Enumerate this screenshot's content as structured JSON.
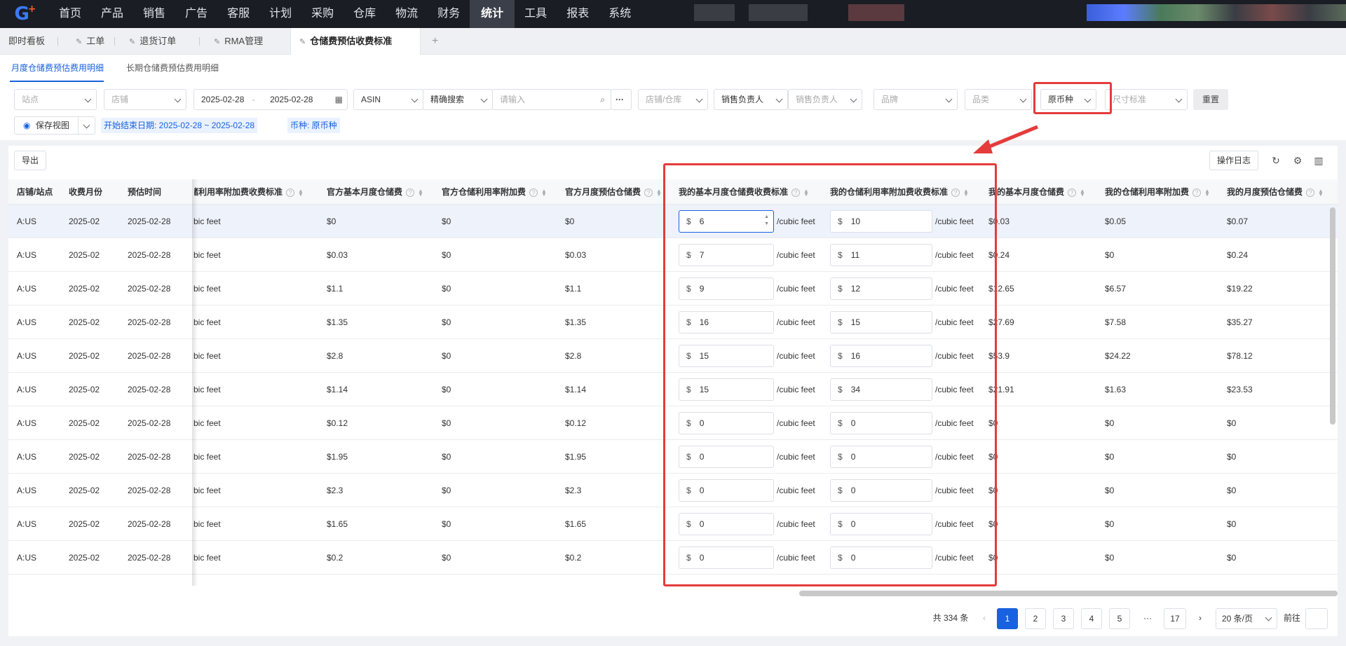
{
  "nav": {
    "items": [
      "首页",
      "产品",
      "销售",
      "广告",
      "客服",
      "计划",
      "采购",
      "仓库",
      "物流",
      "财务",
      "统计",
      "工具",
      "报表",
      "系统"
    ],
    "active_index": 10
  },
  "tabs": {
    "items": [
      {
        "label": "即时看板",
        "pinned": false
      },
      {
        "label": "工单",
        "pinned": true
      },
      {
        "label": "退货订单",
        "pinned": true
      },
      {
        "label": "RMA管理",
        "pinned": true
      },
      {
        "label": "仓储费预估收费标准",
        "pinned": true,
        "active": true
      }
    ],
    "add": "+"
  },
  "subtabs": [
    "月度仓储费预估费用明细",
    "长期仓储费预估费用明细"
  ],
  "filters": {
    "site": "站点",
    "store": "店铺",
    "date_start": "2025-02-28",
    "date_sep": "-",
    "date_end": "2025-02-28",
    "asin": "ASIN",
    "search_mode": "精确搜索",
    "search_placeholder": "请输入",
    "store_warehouse": "店铺/仓库",
    "sales_owner": "销售负责人",
    "sales_owner_ph": "销售负责人",
    "brand": "品牌",
    "category": "品类",
    "currency": "原币种",
    "size_std": "尺寸标准",
    "reset": "重置",
    "save_view": "保存视图",
    "chip_date": "开始结束日期: 2025-02-28 ~ 2025-02-28",
    "chip_currency": "币种: 原币种"
  },
  "toolbar": {
    "export": "导出",
    "log": "操作日志"
  },
  "columns": [
    "店铺/站点",
    "收费月份",
    "预估时间",
    "仓储利用率附加费收费标准",
    "官方基本月度仓储费",
    "官方仓储利用率附加费",
    "官方月度预估仓储费",
    "我的基本月度仓储费收费标准",
    "我的仓储利用率附加费收费标准",
    "我的基本月度仓储费",
    "我的仓储利用率附加费",
    "我的月度预估仓储费"
  ],
  "rows": [
    {
      "store": "A:US",
      "month": "2025-02",
      "est": "2025-02-28",
      "surcharge_std": "bic feet",
      "off_base": "$0",
      "off_surcharge": "$0",
      "off_total": "$0",
      "my_base_std": "6",
      "my_sur_std": "10",
      "my_base": "$0.03",
      "my_sur": "$0.05",
      "my_total": "$0.07"
    },
    {
      "store": "A:US",
      "month": "2025-02",
      "est": "2025-02-28",
      "surcharge_std": "bic feet",
      "off_base": "$0.03",
      "off_surcharge": "$0",
      "off_total": "$0.03",
      "my_base_std": "7",
      "my_sur_std": "11",
      "my_base": "$0.24",
      "my_sur": "$0",
      "my_total": "$0.24"
    },
    {
      "store": "A:US",
      "month": "2025-02",
      "est": "2025-02-28",
      "surcharge_std": "bic feet",
      "off_base": "$1.1",
      "off_surcharge": "$0",
      "off_total": "$1.1",
      "my_base_std": "9",
      "my_sur_std": "12",
      "my_base": "$12.65",
      "my_sur": "$6.57",
      "my_total": "$19.22"
    },
    {
      "store": "A:US",
      "month": "2025-02",
      "est": "2025-02-28",
      "surcharge_std": "bic feet",
      "off_base": "$1.35",
      "off_surcharge": "$0",
      "off_total": "$1.35",
      "my_base_std": "16",
      "my_sur_std": "15",
      "my_base": "$27.69",
      "my_sur": "$7.58",
      "my_total": "$35.27"
    },
    {
      "store": "A:US",
      "month": "2025-02",
      "est": "2025-02-28",
      "surcharge_std": "bic feet",
      "off_base": "$2.8",
      "off_surcharge": "$0",
      "off_total": "$2.8",
      "my_base_std": "15",
      "my_sur_std": "16",
      "my_base": "$53.9",
      "my_sur": "$24.22",
      "my_total": "$78.12"
    },
    {
      "store": "A:US",
      "month": "2025-02",
      "est": "2025-02-28",
      "surcharge_std": "bic feet",
      "off_base": "$1.14",
      "off_surcharge": "$0",
      "off_total": "$1.14",
      "my_base_std": "15",
      "my_sur_std": "34",
      "my_base": "$21.91",
      "my_sur": "$1.63",
      "my_total": "$23.53"
    },
    {
      "store": "A:US",
      "month": "2025-02",
      "est": "2025-02-28",
      "surcharge_std": "bic feet",
      "off_base": "$0.12",
      "off_surcharge": "$0",
      "off_total": "$0.12",
      "my_base_std": "0",
      "my_sur_std": "0",
      "my_base": "$0",
      "my_sur": "$0",
      "my_total": "$0"
    },
    {
      "store": "A:US",
      "month": "2025-02",
      "est": "2025-02-28",
      "surcharge_std": "bic feet",
      "off_base": "$1.95",
      "off_surcharge": "$0",
      "off_total": "$1.95",
      "my_base_std": "0",
      "my_sur_std": "0",
      "my_base": "$0",
      "my_sur": "$0",
      "my_total": "$0"
    },
    {
      "store": "A:US",
      "month": "2025-02",
      "est": "2025-02-28",
      "surcharge_std": "bic feet",
      "off_base": "$2.3",
      "off_surcharge": "$0",
      "off_total": "$2.3",
      "my_base_std": "0",
      "my_sur_std": "0",
      "my_base": "$0",
      "my_sur": "$0",
      "my_total": "$0"
    },
    {
      "store": "A:US",
      "month": "2025-02",
      "est": "2025-02-28",
      "surcharge_std": "bic feet",
      "off_base": "$1.65",
      "off_surcharge": "$0",
      "off_total": "$1.65",
      "my_base_std": "0",
      "my_sur_std": "0",
      "my_base": "$0",
      "my_sur": "$0",
      "my_total": "$0"
    },
    {
      "store": "A:US",
      "month": "2025-02",
      "est": "2025-02-28",
      "surcharge_std": "bic feet",
      "off_base": "$0.2",
      "off_surcharge": "$0",
      "off_total": "$0.2",
      "my_base_std": "0",
      "my_sur_std": "0",
      "my_base": "$0",
      "my_sur": "$0",
      "my_total": "$0"
    }
  ],
  "cell_labels": {
    "currency_symbol": "$",
    "unit": "/cubic feet"
  },
  "pagination": {
    "total": "共 334 条",
    "pages": [
      "1",
      "2",
      "3",
      "4",
      "5",
      "···",
      "17"
    ],
    "current": "1",
    "per_page": "20 条/页",
    "goto": "前往",
    "prev": "‹",
    "next": "›"
  },
  "colors": {
    "accent": "#1861e0",
    "highlight": "#e53b3b",
    "nav_bg": "#1a1d24"
  }
}
